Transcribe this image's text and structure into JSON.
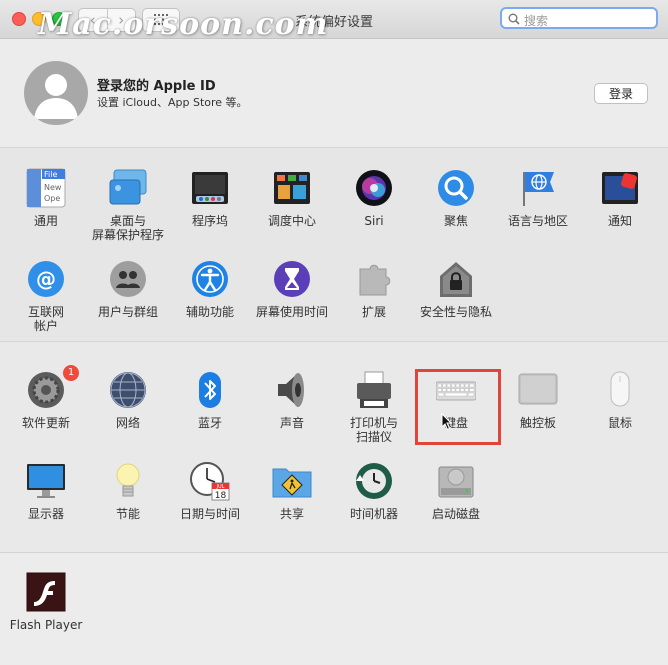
{
  "window": {
    "title": "系统偏好设置"
  },
  "watermark": "Mac.orsoon.com",
  "search": {
    "placeholder": "搜索"
  },
  "apple_id": {
    "title": "登录您的 Apple ID",
    "subtitle": "设置 iCloud、App Store 等。",
    "login_label": "登录"
  },
  "row1": [
    {
      "label": "通用",
      "icon": "general-icon"
    },
    {
      "label": "桌面与\n屏幕保护程序",
      "icon": "desktop-screensaver-icon"
    },
    {
      "label": "程序坞",
      "icon": "dock-icon"
    },
    {
      "label": "调度中心",
      "icon": "mission-control-icon"
    },
    {
      "label": "Siri",
      "icon": "siri-icon"
    },
    {
      "label": "聚焦",
      "icon": "spotlight-icon"
    },
    {
      "label": "语言与地区",
      "icon": "language-region-icon"
    },
    {
      "label": "通知",
      "icon": "notifications-icon"
    }
  ],
  "row2": [
    {
      "label": "互联网\n帐户",
      "icon": "internet-accounts-icon"
    },
    {
      "label": "用户与群组",
      "icon": "users-groups-icon"
    },
    {
      "label": "辅助功能",
      "icon": "accessibility-icon"
    },
    {
      "label": "屏幕使用时间",
      "icon": "screen-time-icon"
    },
    {
      "label": "扩展",
      "icon": "extensions-icon"
    },
    {
      "label": "安全性与隐私",
      "icon": "security-privacy-icon"
    }
  ],
  "row3": [
    {
      "label": "软件更新",
      "icon": "software-update-icon",
      "badge": "1"
    },
    {
      "label": "网络",
      "icon": "network-icon"
    },
    {
      "label": "蓝牙",
      "icon": "bluetooth-icon"
    },
    {
      "label": "声音",
      "icon": "sound-icon"
    },
    {
      "label": "打印机与\n扫描仪",
      "icon": "printers-scanners-icon"
    },
    {
      "label": "键盘",
      "icon": "keyboard-icon"
    },
    {
      "label": "触控板",
      "icon": "trackpad-icon"
    },
    {
      "label": "鼠标",
      "icon": "mouse-icon"
    }
  ],
  "row4": [
    {
      "label": "显示器",
      "icon": "displays-icon"
    },
    {
      "label": "节能",
      "icon": "energy-saver-icon"
    },
    {
      "label": "日期与时间",
      "icon": "date-time-icon",
      "calendar_month": "JUL",
      "calendar_day": "18"
    },
    {
      "label": "共享",
      "icon": "sharing-icon"
    },
    {
      "label": "时间机器",
      "icon": "time-machine-icon"
    },
    {
      "label": "启动磁盘",
      "icon": "startup-disk-icon"
    }
  ],
  "row5": [
    {
      "label": "Flash Player",
      "icon": "flash-player-icon"
    }
  ],
  "general_icon_text": [
    "File",
    "New",
    "Ope"
  ]
}
